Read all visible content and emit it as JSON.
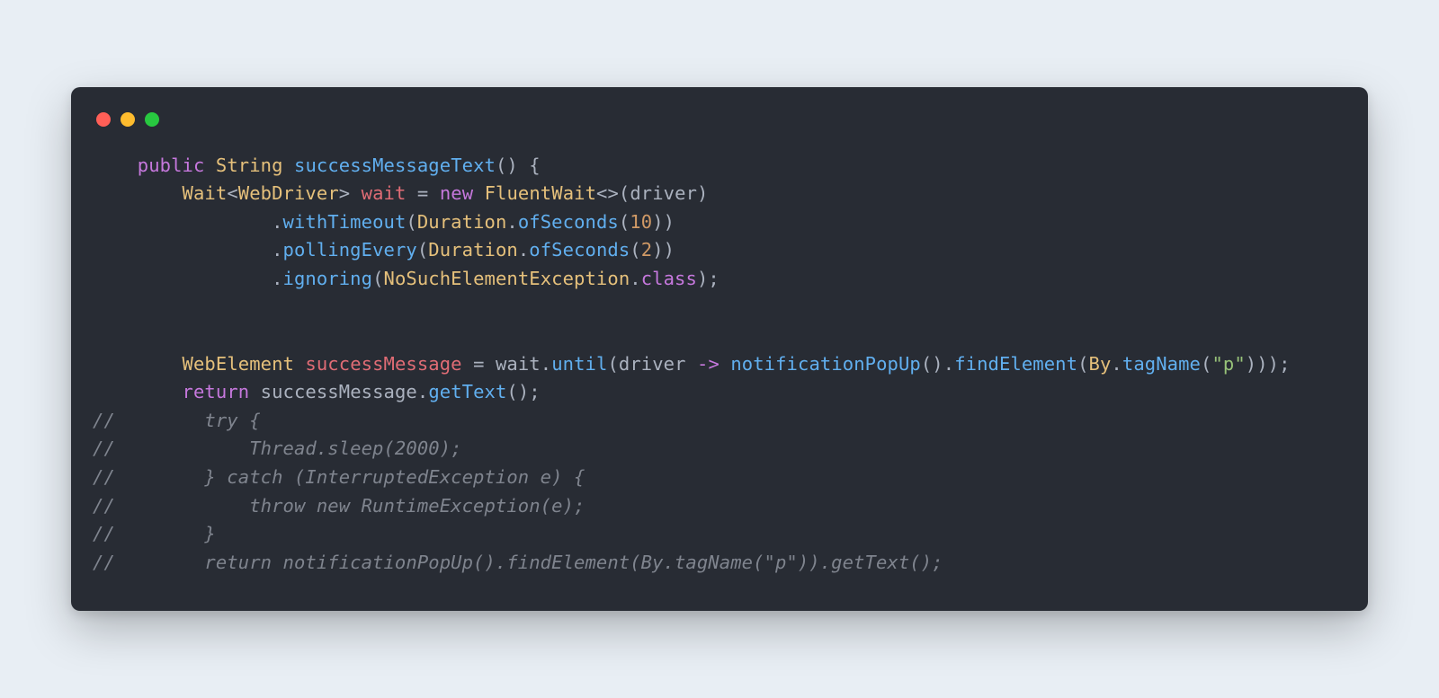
{
  "code": {
    "l1": {
      "indent": "    ",
      "public": "public",
      "sp1": " ",
      "type": "String",
      "sp2": " ",
      "method": "successMessageText",
      "parens_brace": "() {"
    },
    "l2": {
      "indent": "        ",
      "wait_type": "Wait",
      "lt": "<",
      "generic": "WebDriver",
      "gt": ">",
      "sp1": " ",
      "var": "wait",
      "sp2": " ",
      "eq": "=",
      "sp3": " ",
      "new": "new",
      "sp4": " ",
      "cls": "FluentWait",
      "diamond": "<>",
      "open": "(",
      "arg": "driver",
      "close": ")"
    },
    "l3": {
      "indent": "                ",
      "dot": ".",
      "method": "withTimeout",
      "open": "(",
      "cls": "Duration",
      "dot2": ".",
      "method2": "ofSeconds",
      "open2": "(",
      "num": "10",
      "close": "))"
    },
    "l4": {
      "indent": "                ",
      "dot": ".",
      "method": "pollingEvery",
      "open": "(",
      "cls": "Duration",
      "dot2": ".",
      "method2": "ofSeconds",
      "open2": "(",
      "num": "2",
      "close": "))"
    },
    "l5": {
      "indent": "                ",
      "dot": ".",
      "method": "ignoring",
      "open": "(",
      "cls": "NoSuchElementException",
      "dot2": ".",
      "class_kw": "class",
      "close": ");"
    },
    "l6": {
      "indent": "        ",
      "type": "WebElement",
      "sp1": " ",
      "var": "successMessage",
      "sp2": " ",
      "eq": "=",
      "sp3": " ",
      "wait": "wait",
      "dot": ".",
      "until": "until",
      "open": "(",
      "driver": "driver",
      "sp4": " ",
      "arrow": "->",
      "sp5": " ",
      "m1": "notificationPopUp",
      "p1": "()",
      "dot2": ".",
      "m2": "findElement",
      "open2": "(",
      "by": "By",
      "dot3": ".",
      "m3": "tagName",
      "open3": "(",
      "str": "\"p\"",
      "close": ")));"
    },
    "l7": {
      "indent": "        ",
      "return": "return",
      "sp1": " ",
      "var": "successMessage",
      "dot": ".",
      "method": "getText",
      "close": "();"
    },
    "c1": "//        try {",
    "c2": "//            Thread.sleep(2000);",
    "c3": "//        } catch (InterruptedException e) {",
    "c4": "//            throw new RuntimeException(e);",
    "c5": "//        }",
    "c6": "//        return notificationPopUp().findElement(By.tagName(\"p\")).getText();"
  }
}
